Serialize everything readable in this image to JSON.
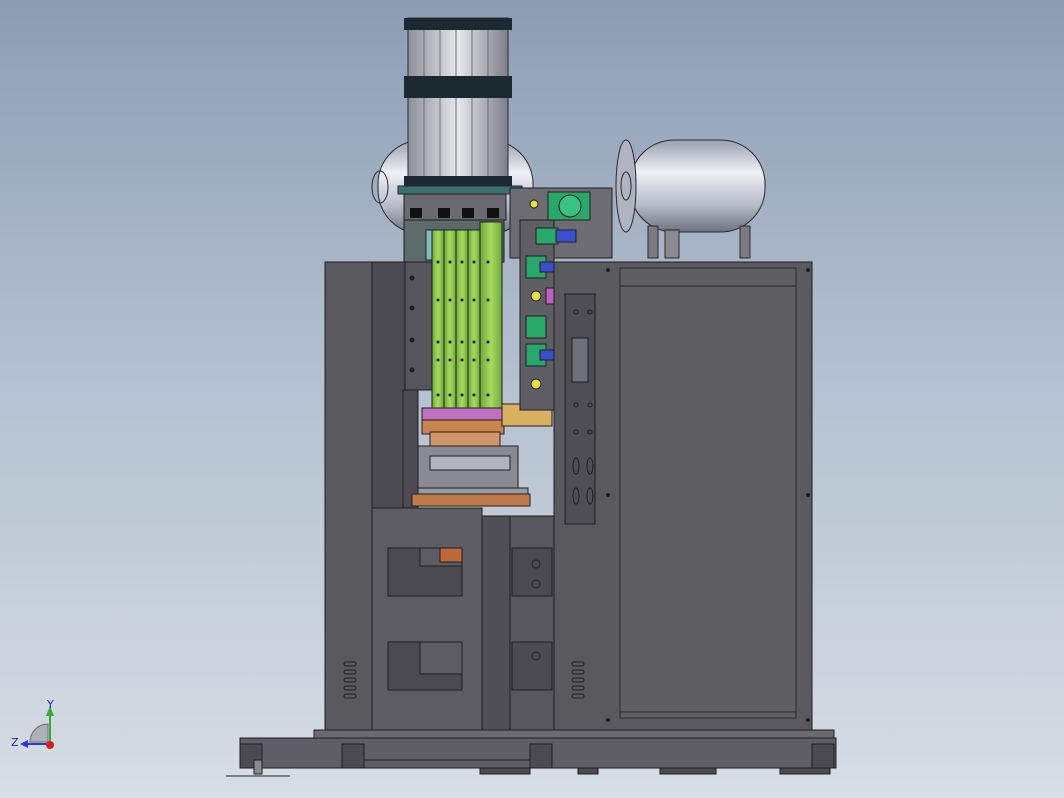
{
  "viewport": {
    "background_top": "#8c9db4",
    "background_bottom": "#d6dee6"
  },
  "model": {
    "frame_color": "#5a5a5e",
    "frame_dark": "#3f3f44",
    "tank_color": "#c9c9d3",
    "bus_bar_color": "#8fc84a",
    "copper_color": "#c07a4a",
    "accent_green": "#2aa86a",
    "accent_blue": "#3a4fd0",
    "accent_yellow": "#e8e040",
    "accent_magenta": "#c060c0"
  },
  "triad": {
    "y_label": "Y",
    "z_label": "Z",
    "icon": "coordinate-axis-triad-icon"
  }
}
